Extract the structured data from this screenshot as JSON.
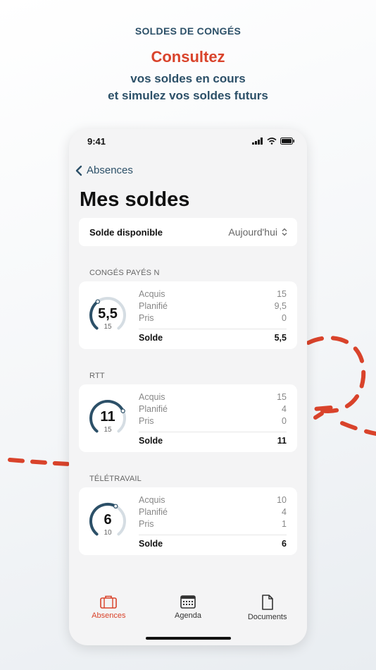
{
  "hero": {
    "eyebrow": "SOLDES DE CONGÉS",
    "headline": "Consultez",
    "line1": "vos soldes en cours",
    "line2": "et simulez vos soldes futurs"
  },
  "status_bar": {
    "time": "9:41"
  },
  "nav": {
    "back_label": "Absences",
    "title": "Mes soldes"
  },
  "filter": {
    "label": "Solde disponible",
    "value": "Aujourd'hui"
  },
  "sections": [
    {
      "label": "CONGÉS PAYÉS N",
      "gauge_value": "5,5",
      "gauge_total": "15",
      "gauge_fraction": 0.37,
      "rows": [
        {
          "label": "Acquis",
          "value": "15"
        },
        {
          "label": "Planifié",
          "value": "9,5"
        },
        {
          "label": "Pris",
          "value": "0"
        }
      ],
      "total": {
        "label": "Solde",
        "value": "5,5"
      }
    },
    {
      "label": "RTT",
      "gauge_value": "11",
      "gauge_total": "15",
      "gauge_fraction": 0.73,
      "rows": [
        {
          "label": "Acquis",
          "value": "15"
        },
        {
          "label": "Planifié",
          "value": "4"
        },
        {
          "label": "Pris",
          "value": "0"
        }
      ],
      "total": {
        "label": "Solde",
        "value": "11"
      }
    },
    {
      "label": "TÉLÉTRAVAIL",
      "gauge_value": "6",
      "gauge_total": "10",
      "gauge_fraction": 0.6,
      "rows": [
        {
          "label": "Acquis",
          "value": "10"
        },
        {
          "label": "Planifié",
          "value": "4"
        },
        {
          "label": "Pris",
          "value": "1"
        }
      ],
      "total": {
        "label": "Solde",
        "value": "6"
      }
    }
  ],
  "tabbar": [
    {
      "label": "Absences",
      "icon": "briefcase-icon",
      "active": true
    },
    {
      "label": "Agenda",
      "icon": "calendar-icon",
      "active": false
    },
    {
      "label": "Documents",
      "icon": "document-icon",
      "active": false
    }
  ],
  "colors": {
    "accent": "#d9432b",
    "primary": "#2c5068",
    "gauge_track": "#d5dde3"
  }
}
